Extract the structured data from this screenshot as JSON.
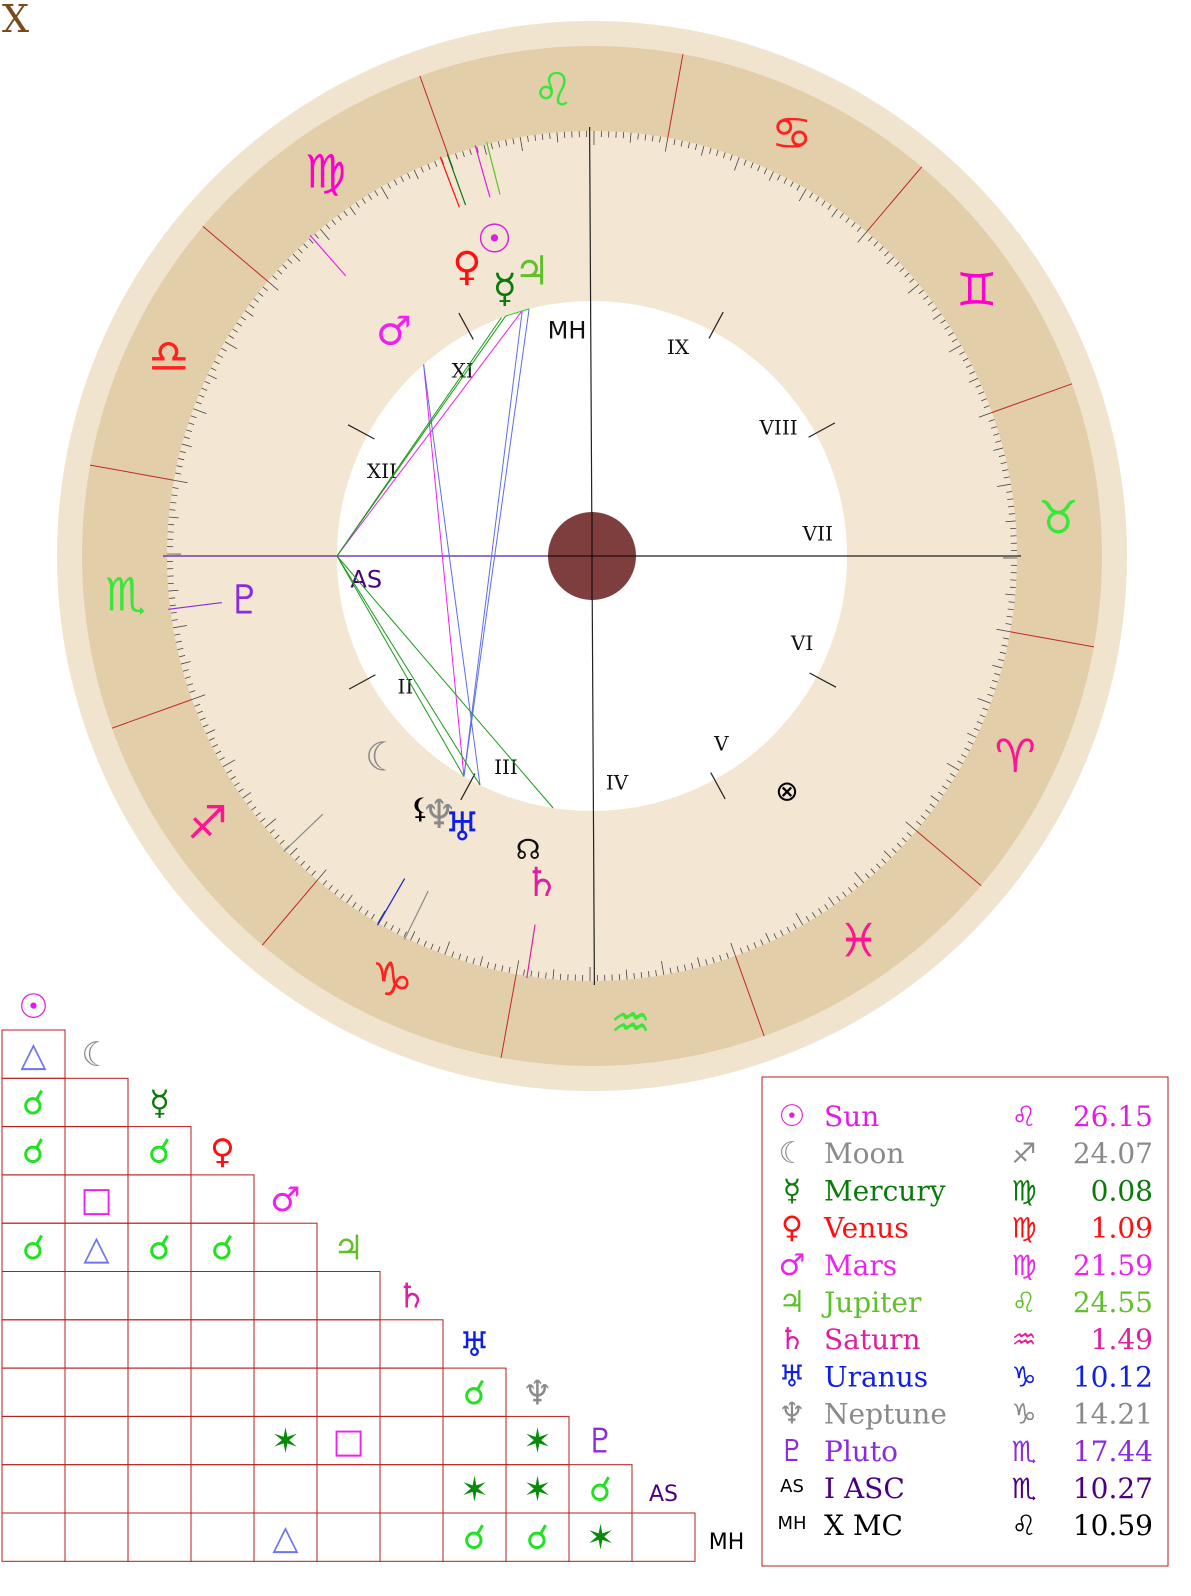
{
  "corner_label": "X",
  "colors": {
    "outer_ring": "#f0e4ce",
    "zodiac_band": "#e3ceaa",
    "house_band": "#f3e7d3",
    "inner_disc": "#ffffff",
    "center_disc": "#7e3e3e",
    "divider": "#c0282a",
    "grid": "#b81c1c",
    "tick": "#444444"
  },
  "zodiac_signs": [
    {
      "name": "Aries",
      "glyph": "♈",
      "color": "#ff1493"
    },
    {
      "name": "Taurus",
      "glyph": "♉",
      "color": "#39e639"
    },
    {
      "name": "Gemini",
      "glyph": "♊",
      "color": "#ff00cc"
    },
    {
      "name": "Cancer",
      "glyph": "♋",
      "color": "#ff2020"
    },
    {
      "name": "Leo",
      "glyph": "♌",
      "color": "#39e639"
    },
    {
      "name": "Virgo",
      "glyph": "♍",
      "color": "#ff00cc"
    },
    {
      "name": "Libra",
      "glyph": "♎",
      "color": "#ff2020"
    },
    {
      "name": "Scorpio",
      "glyph": "♏",
      "color": "#39e639"
    },
    {
      "name": "Sagittarius",
      "glyph": "♐",
      "color": "#ff1493"
    },
    {
      "name": "Capricorn",
      "glyph": "♑",
      "color": "#ff2020"
    },
    {
      "name": "Aquarius",
      "glyph": "♒",
      "color": "#39e639"
    },
    {
      "name": "Pisces",
      "glyph": "♓",
      "color": "#ff1493"
    }
  ],
  "houses": [
    "I",
    "II",
    "III",
    "IV",
    "V",
    "VI",
    "VII",
    "VIII",
    "IX",
    "X",
    "XI",
    "XII"
  ],
  "house_cusps": [
    {
      "label": "AS",
      "degree": 220.27
    },
    {
      "label": "II",
      "degree": 249
    },
    {
      "label": "III",
      "degree": 282
    },
    {
      "label": "IV",
      "degree": 310.59
    },
    {
      "label": "V",
      "degree": 339
    },
    {
      "label": "VI",
      "degree": 12
    },
    {
      "label": "VII",
      "degree": 40.27
    },
    {
      "label": "VIII",
      "degree": 69
    },
    {
      "label": "IX",
      "degree": 102
    },
    {
      "label": "MH",
      "degree": 130.59
    },
    {
      "label": "XI",
      "degree": 159
    },
    {
      "label": "XII",
      "degree": 192
    }
  ],
  "planets": [
    {
      "key": "sun",
      "name": "Sun",
      "glyph": "☉",
      "sign_glyph": "♌",
      "position": "26.15",
      "degree": 146.15,
      "color": "#e01ee0"
    },
    {
      "key": "moon",
      "name": "Moon",
      "glyph": "☾",
      "sign_glyph": "♐",
      "position": "24.07",
      "degree": 264.07,
      "color": "#8a8a8a"
    },
    {
      "key": "mercury",
      "name": "Mercury",
      "glyph": "☿",
      "sign_glyph": "♍",
      "position": "0.08",
      "degree": 150.08,
      "color": "#0a7a0a"
    },
    {
      "key": "venus",
      "name": "Venus",
      "glyph": "♀",
      "sign_glyph": "♍",
      "position": "1.09",
      "degree": 151.09,
      "color": "#ff1010"
    },
    {
      "key": "mars",
      "name": "Mars",
      "glyph": "♂",
      "sign_glyph": "♍",
      "position": "21.59",
      "degree": 171.59,
      "color": "#ee22ee"
    },
    {
      "key": "jupiter",
      "name": "Jupiter",
      "glyph": "♃",
      "sign_glyph": "♌",
      "position": "24.55",
      "degree": 144.55,
      "color": "#5fc02a"
    },
    {
      "key": "saturn",
      "name": "Saturn",
      "glyph": "♄",
      "sign_glyph": "♒",
      "position": "1.49",
      "degree": 301.49,
      "color": "#e01ea0"
    },
    {
      "key": "uranus",
      "name": "Uranus",
      "glyph": "♅",
      "sign_glyph": "♑",
      "position": "10.12",
      "degree": 280.12,
      "color": "#1020e0"
    },
    {
      "key": "neptune",
      "name": "Neptune",
      "glyph": "♆",
      "sign_glyph": "♑",
      "position": "14.21",
      "degree": 284.21,
      "color": "#8a8a8a"
    },
    {
      "key": "pluto",
      "name": "Pluto",
      "glyph": "♇",
      "sign_glyph": "♏",
      "position": "17.44",
      "degree": 227.44,
      "color": "#8a2be2"
    },
    {
      "key": "asc",
      "name": "I ASC",
      "glyph": "AS",
      "sign_glyph": "♏",
      "position": "10.27",
      "degree": 220.27,
      "color": "#4b0082"
    },
    {
      "key": "mc",
      "name": "X MC",
      "glyph": "MH",
      "sign_glyph": "♌",
      "position": "10.59",
      "degree": 130.59,
      "color": "#000000"
    }
  ],
  "extra_points": [
    {
      "name": "node",
      "glyph": "☊",
      "color": "#111111"
    },
    {
      "name": "lilith",
      "glyph": "⚸",
      "color": "#000000"
    },
    {
      "name": "fortune",
      "glyph": "⊗",
      "color": "#000000"
    }
  ],
  "aspect_symbols": {
    "trine": {
      "glyph": "△",
      "color": "#6f74f0"
    },
    "conjunction": {
      "glyph": "☌",
      "color": "#22e022"
    },
    "square": {
      "glyph": "□",
      "color": "#ee22ee"
    },
    "sextile": {
      "glyph": "✶",
      "color": "#0a8a0a"
    }
  },
  "aspect_grid": [
    {
      "row": 1,
      "col": 0,
      "aspect": "trine"
    },
    {
      "row": 2,
      "col": 0,
      "aspect": "conjunction"
    },
    {
      "row": 3,
      "col": 0,
      "aspect": "conjunction"
    },
    {
      "row": 3,
      "col": 2,
      "aspect": "conjunction"
    },
    {
      "row": 4,
      "col": 1,
      "aspect": "square"
    },
    {
      "row": 5,
      "col": 0,
      "aspect": "conjunction"
    },
    {
      "row": 5,
      "col": 1,
      "aspect": "trine"
    },
    {
      "row": 5,
      "col": 2,
      "aspect": "conjunction"
    },
    {
      "row": 5,
      "col": 3,
      "aspect": "conjunction"
    },
    {
      "row": 8,
      "col": 7,
      "aspect": "conjunction"
    },
    {
      "row": 9,
      "col": 4,
      "aspect": "sextile"
    },
    {
      "row": 9,
      "col": 5,
      "aspect": "square"
    },
    {
      "row": 9,
      "col": 8,
      "aspect": "sextile"
    },
    {
      "row": 10,
      "col": 7,
      "aspect": "sextile"
    },
    {
      "row": 10,
      "col": 8,
      "aspect": "sextile"
    },
    {
      "row": 10,
      "col": 9,
      "aspect": "conjunction"
    },
    {
      "row": 11,
      "col": 4,
      "aspect": "trine"
    },
    {
      "row": 11,
      "col": 7,
      "aspect": "conjunction"
    },
    {
      "row": 11,
      "col": 8,
      "aspect": "conjunction"
    },
    {
      "row": 11,
      "col": 9,
      "aspect": "sextile"
    }
  ],
  "aspect_lines": [
    {
      "from": "sun",
      "to": "asc",
      "color": "#ee22ee"
    },
    {
      "from": "mars",
      "to": "uranus",
      "color": "#ee22ee"
    },
    {
      "from": "sun",
      "to": "uranus",
      "color": "#5c6cf0"
    },
    {
      "from": "jupiter",
      "to": "uranus",
      "color": "#5c6cf0"
    },
    {
      "from": "mars",
      "to": "neptune",
      "color": "#5c6cf0"
    },
    {
      "from": "mercury",
      "to": "asc",
      "color": "#1a9a1a"
    },
    {
      "from": "venus",
      "to": "asc",
      "color": "#1a9a1a"
    },
    {
      "from": "asc",
      "to": "uranus",
      "color": "#1a9a1a"
    },
    {
      "from": "asc",
      "to": "neptune",
      "color": "#1a9a1a"
    },
    {
      "from": "asc",
      "to": "saturn",
      "color": "#1a9a1a"
    },
    {
      "from": "mercury",
      "to": "jupiter",
      "color": "#2ad02a"
    }
  ]
}
